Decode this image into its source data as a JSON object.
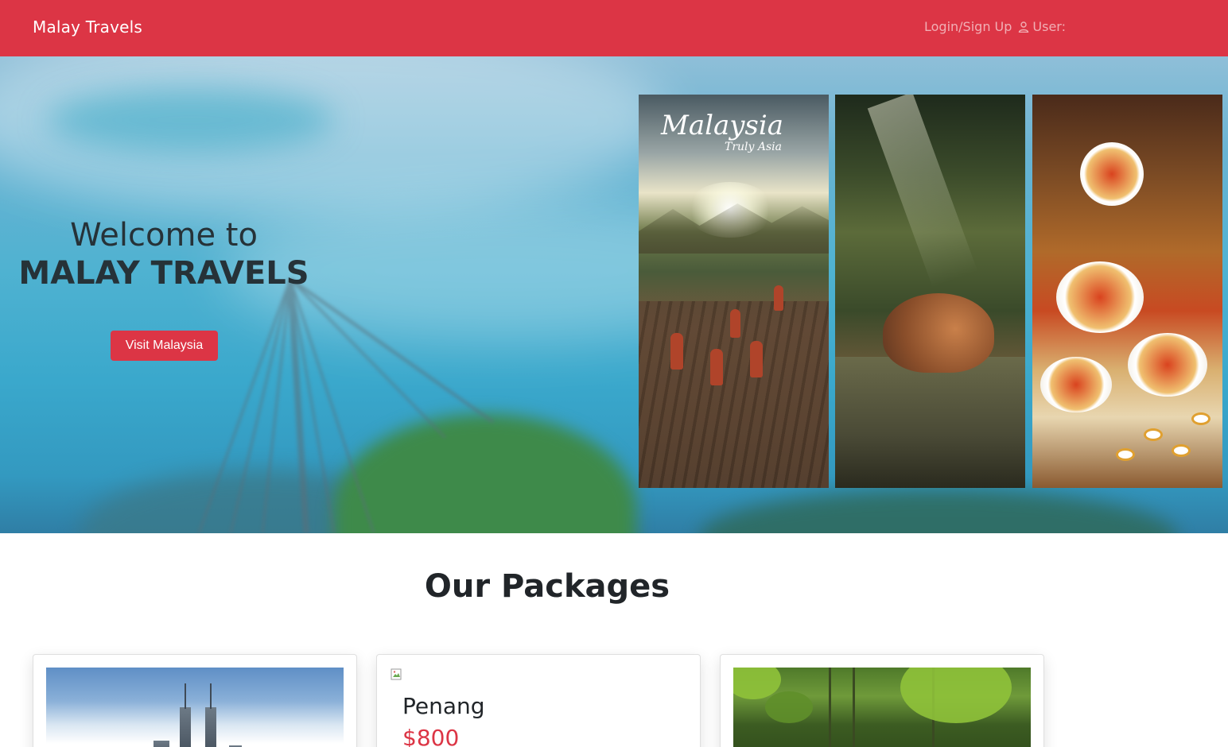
{
  "navbar": {
    "brand": "Malay Travels",
    "login_label": "Login/Sign Up",
    "user_label": "User:"
  },
  "hero": {
    "welcome_line": "Welcome to",
    "welcome_title": "MALAY TRAVELS",
    "cta_label": "Visit Malaysia",
    "poster_logo_main": "Malaysia",
    "poster_logo_sub": "Truly Asia"
  },
  "packages": {
    "heading": "Our Packages",
    "cards": [
      {
        "title": "",
        "price": "",
        "image": "kuala-lumpur-skyline"
      },
      {
        "title": "Penang",
        "price": "$800",
        "image": "broken-image"
      },
      {
        "title": "",
        "price": "",
        "image": "rainforest"
      }
    ]
  },
  "colors": {
    "brand_red": "#dc3545",
    "white": "#ffffff",
    "text_dark": "#212529"
  }
}
